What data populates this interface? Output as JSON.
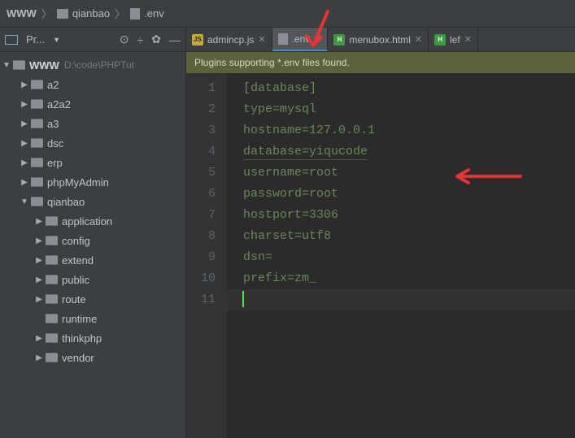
{
  "breadcrumb": {
    "root": "WWW",
    "folder": "qianbao",
    "file": ".env"
  },
  "sidebar": {
    "toolbar": {
      "label": "Pr..."
    },
    "root": {
      "label": "WWW",
      "path": "D:\\code\\PHPTut"
    },
    "items": [
      {
        "label": "a2",
        "depth": 1,
        "expanded": false
      },
      {
        "label": "a2a2",
        "depth": 1,
        "expanded": false
      },
      {
        "label": "a3",
        "depth": 1,
        "expanded": false
      },
      {
        "label": "dsc",
        "depth": 1,
        "expanded": false
      },
      {
        "label": "erp",
        "depth": 1,
        "expanded": false
      },
      {
        "label": "phpMyAdmin",
        "depth": 1,
        "expanded": false
      },
      {
        "label": "qianbao",
        "depth": 1,
        "expanded": true
      },
      {
        "label": "application",
        "depth": 2,
        "expanded": false
      },
      {
        "label": "config",
        "depth": 2,
        "expanded": false
      },
      {
        "label": "extend",
        "depth": 2,
        "expanded": false
      },
      {
        "label": "public",
        "depth": 2,
        "expanded": false
      },
      {
        "label": "route",
        "depth": 2,
        "expanded": false
      },
      {
        "label": "runtime",
        "depth": 2,
        "expanded": null
      },
      {
        "label": "thinkphp",
        "depth": 2,
        "expanded": false
      },
      {
        "label": "vendor",
        "depth": 2,
        "expanded": false
      }
    ]
  },
  "tabs": [
    {
      "label": "admincp.js",
      "type": "js",
      "active": false
    },
    {
      "label": ".env",
      "type": "file",
      "active": true
    },
    {
      "label": "menubox.html",
      "type": "html",
      "active": false
    },
    {
      "label": "lef",
      "type": "html",
      "active": false
    }
  ],
  "banner": "Plugins supporting *.env files found.",
  "editor": {
    "lines": [
      "[database]",
      "type=mysql",
      "hostname=127.0.0.1",
      "database=yiqucode",
      "username=root",
      "password=root",
      "hostport=3306",
      "charset=utf8",
      "dsn=",
      "prefix=zm_",
      ""
    ],
    "highlighted_line": 4,
    "cursor_line": 11
  },
  "colors": {
    "background": "#3c3f41",
    "editor_bg": "#2b2b2b",
    "text_code": "#6a8759",
    "arrow": "#e63434"
  }
}
